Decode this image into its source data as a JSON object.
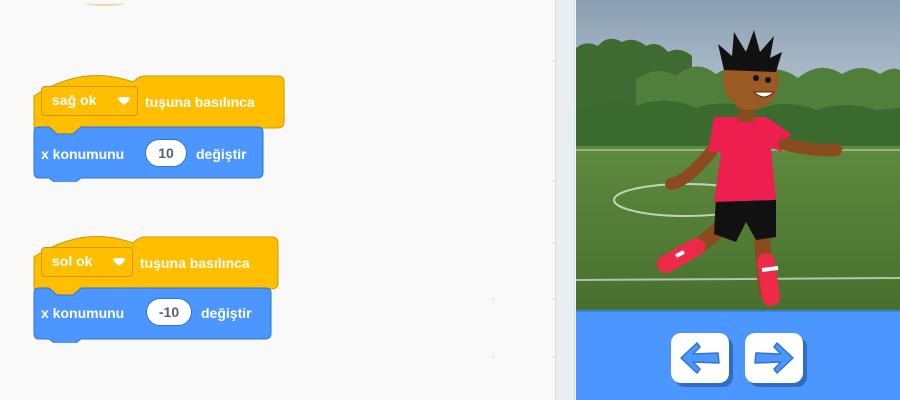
{
  "scripts": [
    {
      "hat": {
        "key": "sağ ok",
        "event_text": "tuşuna basılınca"
      },
      "command": {
        "label": "x konumunu",
        "value": "10",
        "suffix": "değiştir"
      }
    },
    {
      "hat": {
        "key": "sol ok",
        "event_text": "tuşuna basılınca"
      },
      "command": {
        "label": "x konumunu",
        "value": "-10",
        "suffix": "değiştir"
      }
    }
  ],
  "stage": {
    "backdrop": "soccer field",
    "sprite": "soccer player"
  },
  "controls": {
    "left_button_icon": "arrow-left-icon",
    "right_button_icon": "arrow-right-icon"
  },
  "colors": {
    "event_block": "#ffbf00",
    "motion_block": "#4c97ff",
    "controls_bar": "#4c97ff",
    "arrow_icon": "#4c97ff"
  }
}
